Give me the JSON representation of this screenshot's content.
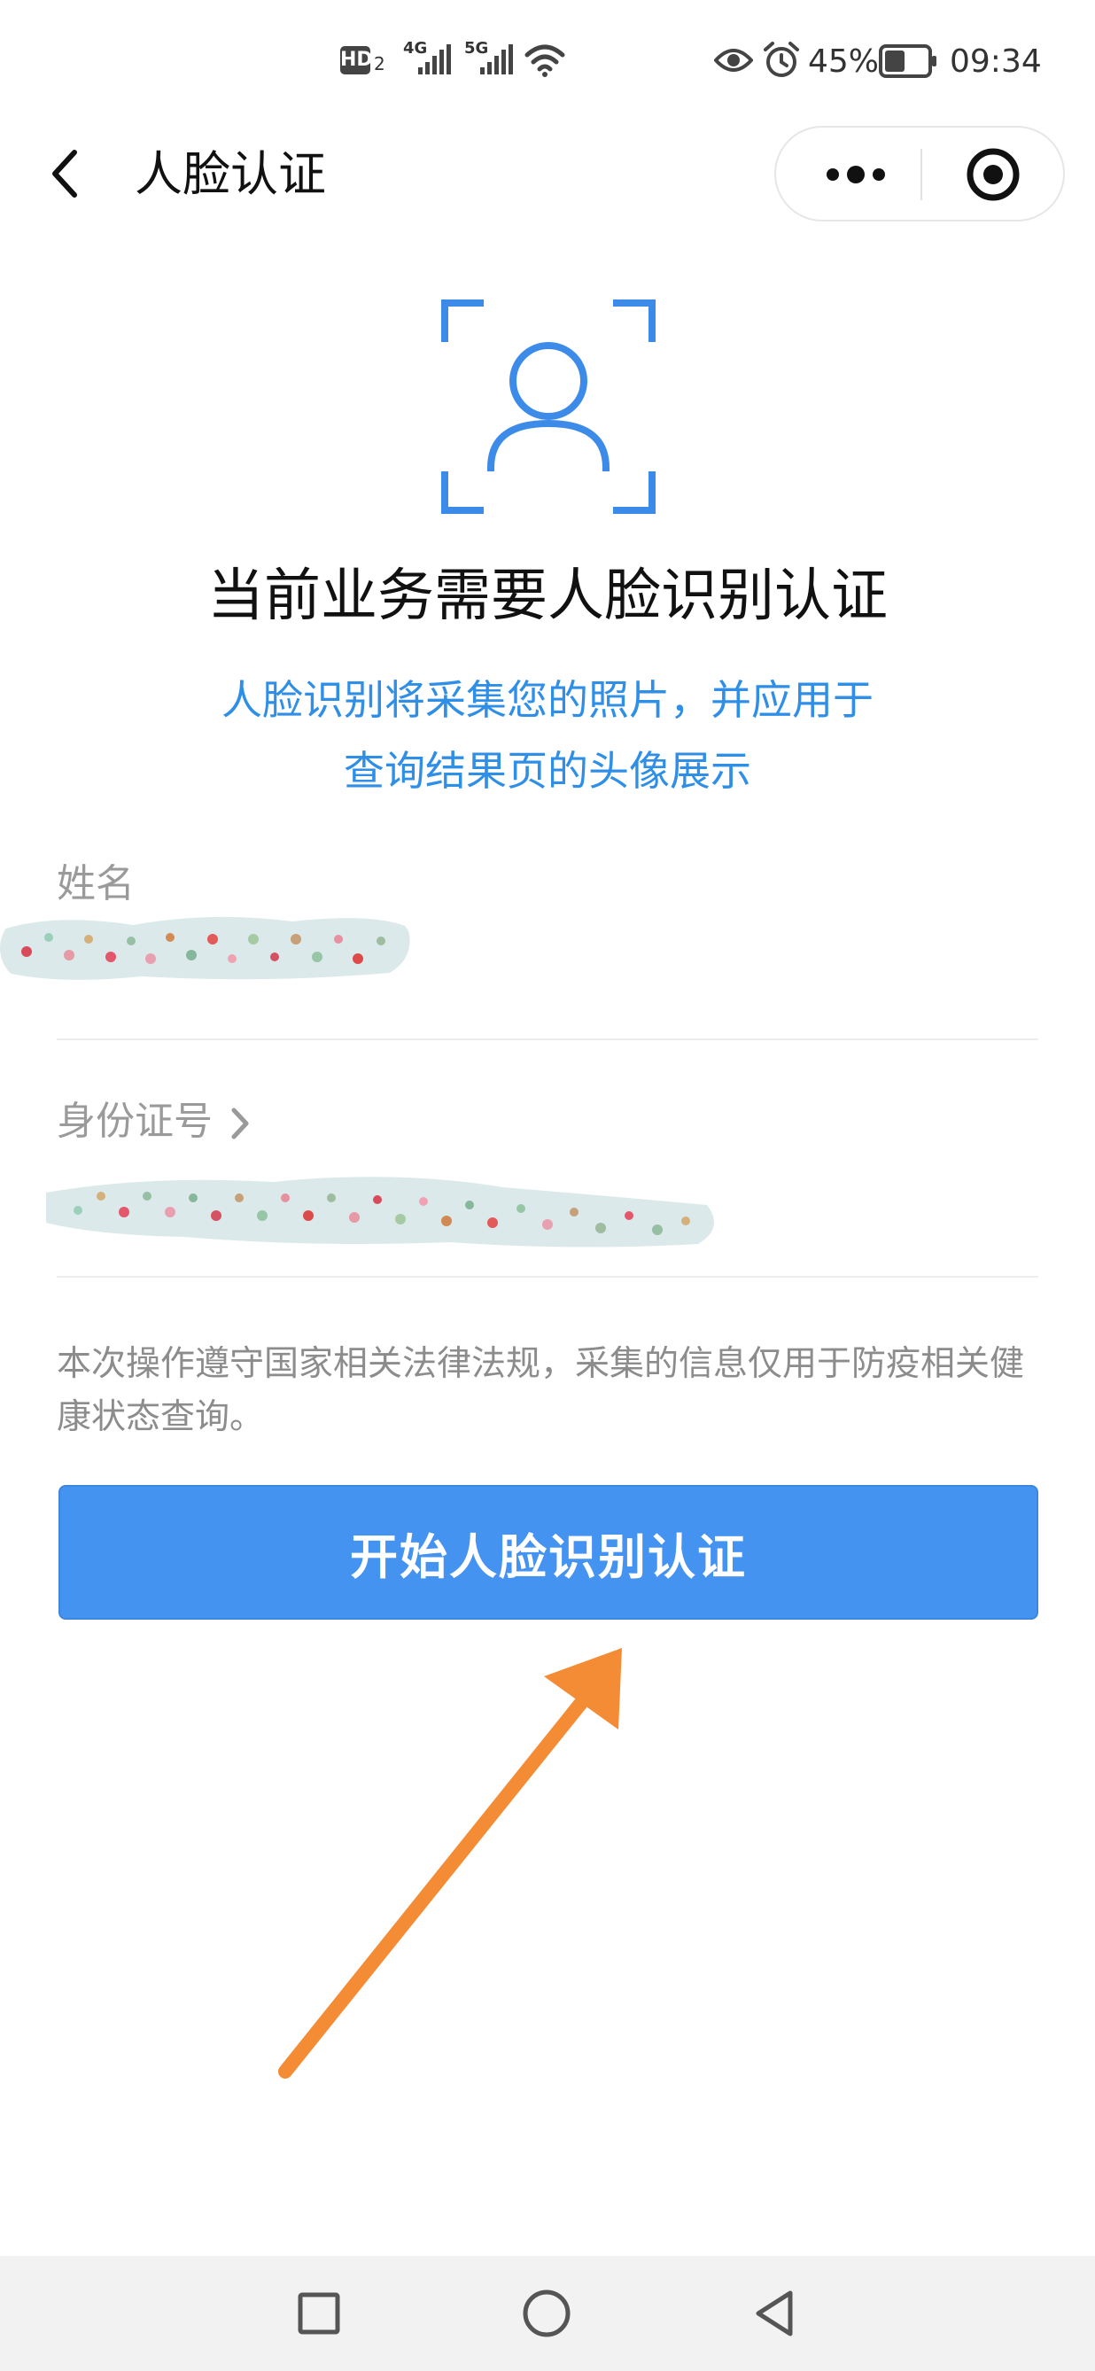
{
  "status_bar": {
    "hd_label": "HD",
    "hd_sub": "2",
    "network_1": "4G",
    "network_2": "5G",
    "battery_percent": "45%",
    "time": "09:34",
    "icons": [
      "eye-icon",
      "alarm-icon",
      "battery-icon",
      "wifi-icon",
      "signal-icon"
    ]
  },
  "nav": {
    "title": "人脸认证",
    "back_icon": "chevron-left-icon",
    "more_icon": "more-dots-icon",
    "close_icon": "target-circle-icon"
  },
  "main": {
    "heading": "当前业务需要人脸识别认证",
    "subtext_line1": "人脸识别将采集您的照片，并应用于",
    "subtext_line2": "查询结果页的头像展示",
    "face_icon": "face-scan-icon"
  },
  "form": {
    "name_label": "姓名",
    "id_label": "身份证号",
    "name_value_redacted": true,
    "id_value_redacted": true
  },
  "notice": "本次操作遵守国家相关法律法规，采集的信息仅用于防疫相关健康状态查询。",
  "primary_button": "开始人脸识别认证",
  "colors": {
    "accent": "#4593f1",
    "link_text": "#2f8ee6",
    "annotation_arrow": "#f48c35"
  }
}
